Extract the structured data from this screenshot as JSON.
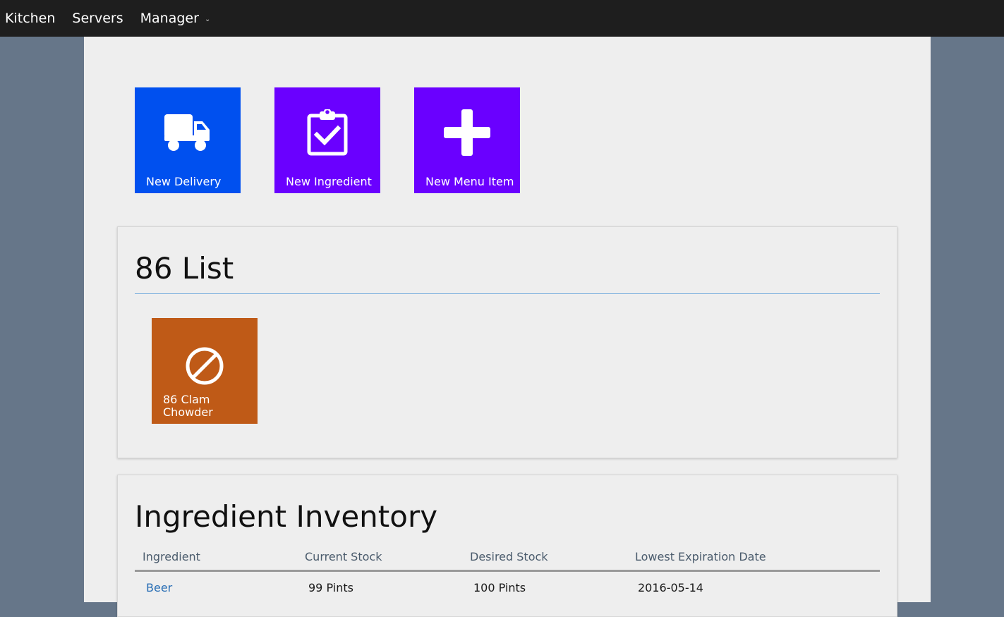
{
  "nav": {
    "items": [
      {
        "label": "Kitchen"
      },
      {
        "label": "Servers"
      },
      {
        "label": "Manager"
      }
    ]
  },
  "colors": {
    "topbar": "#1e1e1e",
    "backdrop": "#667689",
    "page": "#eeeeee",
    "tile_blue": "#0050ef",
    "tile_violet": "#6a00ff",
    "tile_orange": "#bf5a17"
  },
  "actions": [
    {
      "label": "New Delivery",
      "icon": "truck-icon"
    },
    {
      "label": "New Ingredient",
      "icon": "clipboard-check-icon"
    },
    {
      "label": "New Menu Item",
      "icon": "plus-icon"
    }
  ],
  "eighty_six": {
    "title": "86 List",
    "items": [
      {
        "label": "86 Clam Chowder",
        "icon": "ban-icon"
      }
    ]
  },
  "inventory": {
    "title": "Ingredient Inventory",
    "columns": [
      "Ingredient",
      "Current Stock",
      "Desired Stock",
      "Lowest Expiration Date"
    ],
    "rows": [
      {
        "ingredient": "Beer",
        "current": "99 Pints",
        "desired": "100 Pints",
        "expiration": "2016-05-14"
      }
    ]
  }
}
